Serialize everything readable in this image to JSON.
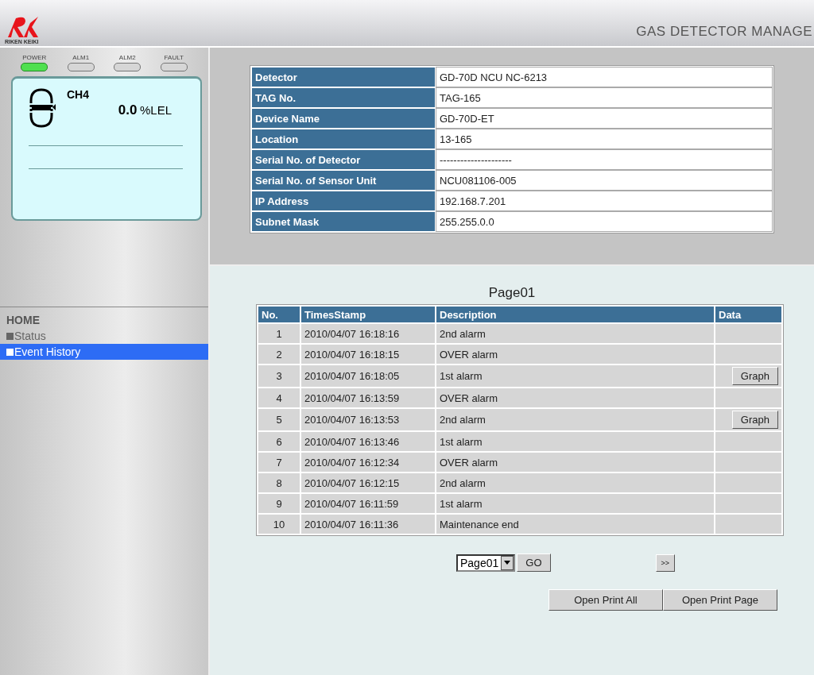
{
  "header": {
    "brand": "RIKEN KEIKI",
    "title": "GAS DETECTOR MANAGE"
  },
  "leds": [
    {
      "label": "POWER",
      "on": true
    },
    {
      "label": "ALM1",
      "on": false
    },
    {
      "label": "ALM2",
      "on": false
    },
    {
      "label": "FAULT",
      "on": false
    }
  ],
  "channel": {
    "gas": "CH4",
    "value": "0.0",
    "unit": "%LEL"
  },
  "nav": {
    "heading": "HOME",
    "items": [
      {
        "label": "Status",
        "selected": false
      },
      {
        "label": "Event History",
        "selected": true
      }
    ]
  },
  "info": [
    {
      "label": "Detector",
      "value": "GD-70D NCU NC-6213"
    },
    {
      "label": "TAG No.",
      "value": "TAG-165"
    },
    {
      "label": "Device Name",
      "value": "GD-70D-ET"
    },
    {
      "label": "Location",
      "value": "13-165"
    },
    {
      "label": "Serial No. of Detector",
      "value": "---------------------"
    },
    {
      "label": "Serial No. of Sensor Unit",
      "value": "NCU081106-005"
    },
    {
      "label": "IP Address",
      "value": "192.168.7.201"
    },
    {
      "label": "Subnet Mask",
      "value": "255.255.0.0"
    }
  ],
  "page_title": "Page01",
  "events": {
    "columns": [
      "No.",
      "TimesStamp",
      "Description",
      "Data"
    ],
    "rows": [
      {
        "no": "1",
        "time": "2010/04/07 16:18:16",
        "description": "2nd alarm"
      },
      {
        "no": "2",
        "time": "2010/04/07 16:18:15",
        "description": "OVER alarm"
      },
      {
        "no": "3",
        "time": "2010/04/07 16:18:05",
        "description": "1st alarm",
        "data": "Graph"
      },
      {
        "no": "4",
        "time": "2010/04/07 16:13:59",
        "description": "OVER alarm"
      },
      {
        "no": "5",
        "time": "2010/04/07 16:13:53",
        "description": "2nd alarm",
        "data": "Graph"
      },
      {
        "no": "6",
        "time": "2010/04/07 16:13:46",
        "description": "1st alarm"
      },
      {
        "no": "7",
        "time": "2010/04/07 16:12:34",
        "description": "OVER alarm"
      },
      {
        "no": "8",
        "time": "2010/04/07 16:12:15",
        "description": "2nd alarm"
      },
      {
        "no": "9",
        "time": "2010/04/07 16:11:59",
        "description": "1st alarm"
      },
      {
        "no": "10",
        "time": "2010/04/07 16:11:36",
        "description": "Maintenance end"
      }
    ]
  },
  "pager": {
    "select": "Page01",
    "go": "GO",
    "next": ">>"
  },
  "buttons": [
    "Open Print All",
    "Open Print Page"
  ]
}
